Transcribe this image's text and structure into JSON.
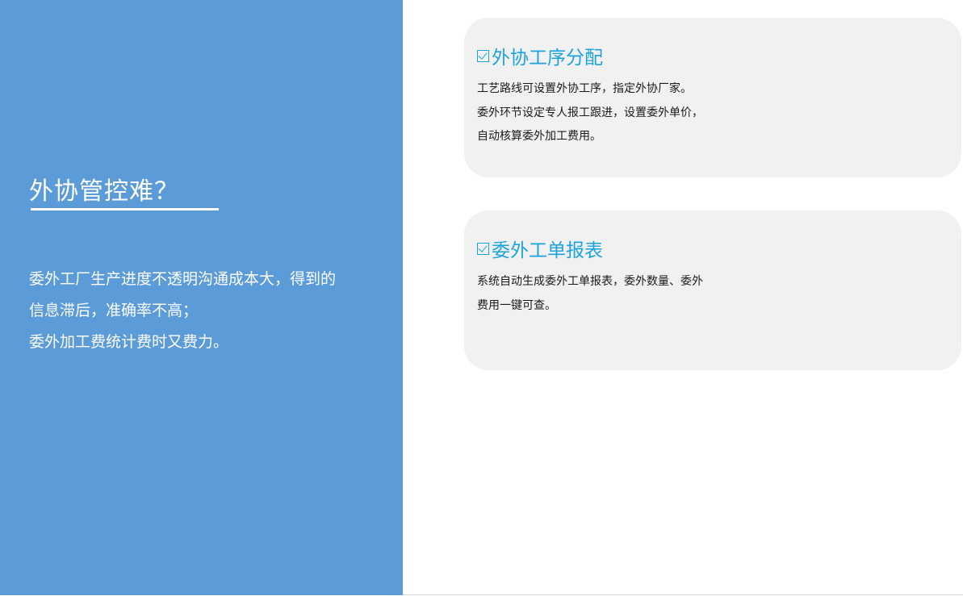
{
  "left": {
    "title": "外协管控难？",
    "description": [
      "委外工厂生产进度不透明沟通成本大，得到的",
      "信息滞后，准确率不高；",
      "委外加工费统计费时又费力。"
    ]
  },
  "cards": [
    {
      "title": "外协工序分配",
      "lines": [
        "工艺路线可设置外协工序，指定外协厂家。",
        "委外环节设定专人报工跟进，设置委外单价，",
        "自动核算委外加工费用。"
      ]
    },
    {
      "title": "委外工单报表",
      "lines": [
        "系统自动生成委外工单报表，委外数量、委外",
        "费用一键可查。"
      ]
    }
  ],
  "colors": {
    "left_panel": "#5b9bd8",
    "card_bg": "#f1f1f1",
    "accent": "#1ba3e0",
    "body_text": "#1a1a1a"
  },
  "icons": {
    "card_title_icon": "checkbox-checked-icon"
  }
}
